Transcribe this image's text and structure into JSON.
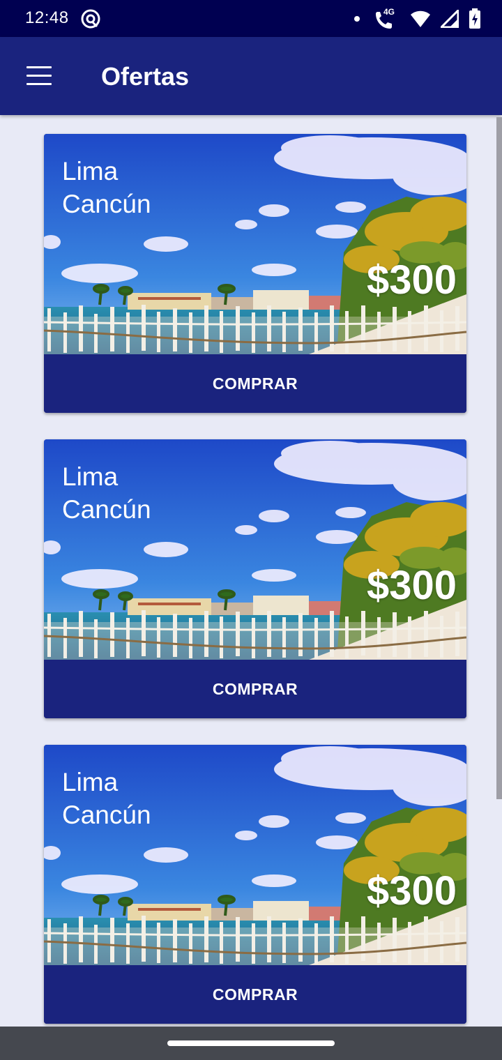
{
  "status_bar": {
    "time": "12:48",
    "network": "4G",
    "icons": [
      "notification-dot-icon",
      "wifi-calling-icon",
      "wifi-icon",
      "cellular-signal-icon",
      "battery-charging-icon"
    ]
  },
  "app_bar": {
    "title": "Ofertas",
    "menu_icon": "hamburger-menu-icon"
  },
  "offers": [
    {
      "origin": "Lima",
      "destination": "Cancún",
      "price": "$300",
      "button_label": "COMPRAR"
    },
    {
      "origin": "Lima",
      "destination": "Cancún",
      "price": "$300",
      "button_label": "COMPRAR"
    },
    {
      "origin": "Lima",
      "destination": "Cancún",
      "price": "$300",
      "button_label": "COMPRAR"
    }
  ],
  "colors": {
    "primary": "#1a237e",
    "primary_dark": "#000051",
    "background": "#e8eaf6",
    "navigation_bar": "#45484f"
  }
}
